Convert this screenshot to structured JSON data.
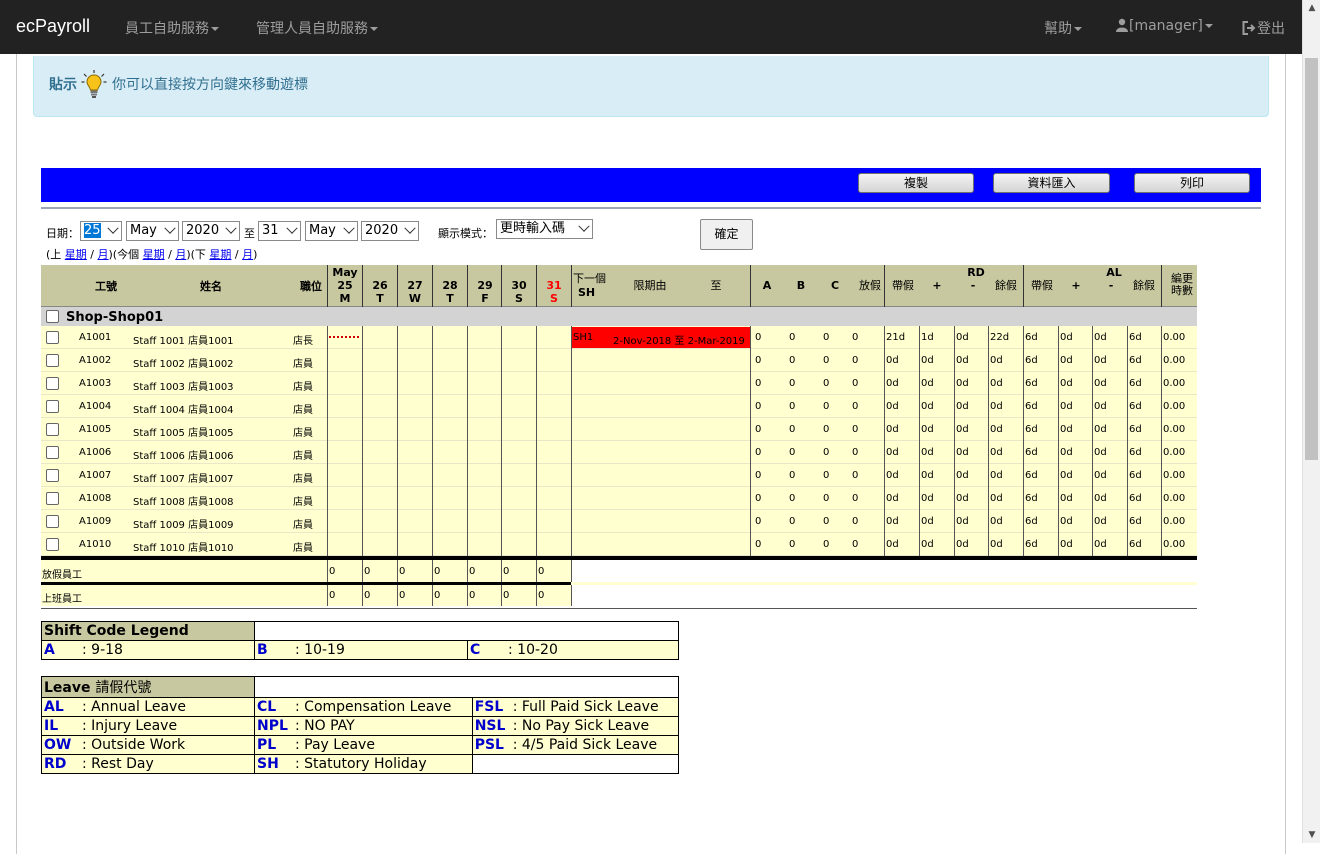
{
  "nav": {
    "brand": "ecPayroll",
    "employee_self_service": "員工自助服務",
    "manager_self_service": "管理人員自助服務",
    "help": "幫助",
    "user": "[manager]",
    "logout": "登出"
  },
  "tip": {
    "label": "貼示",
    "text": "你可以直接按方向鍵來移動遊標"
  },
  "toolbar": {
    "copy": "複製",
    "import": "資料匯入",
    "print": "列印"
  },
  "filters": {
    "date_label": "日期：",
    "to_label": "至",
    "from_day": "25",
    "from_month": "May",
    "from_year": "2020",
    "to_day": "31",
    "to_month": "May",
    "to_year": "2020",
    "mode_label": "顯示模式：",
    "mode_value": "更時輸入碼",
    "confirm": "確定",
    "prev_open": "(上",
    "week": "星期",
    "slash": "/",
    "month": "月",
    "this_open": ")(今個",
    "next_open": ")(下",
    "close": ")"
  },
  "table": {
    "headers": {
      "emp_no": "工號",
      "name": "姓名",
      "position": "職位",
      "next": "下一個",
      "next_code": "SH",
      "period_from": "限期由",
      "period_to": "至",
      "A": "A",
      "B": "B",
      "C": "C",
      "leave": "放假",
      "rd": "RD",
      "al": "AL",
      "with_leave": "帶假",
      "plus": "+",
      "minus": "-",
      "balance": "餘假",
      "shift_hours": "編更時數"
    },
    "days": [
      {
        "top": "May",
        "num": "25",
        "dow": "M",
        "red": false
      },
      {
        "top": "",
        "num": "26",
        "dow": "T",
        "red": false
      },
      {
        "top": "",
        "num": "27",
        "dow": "W",
        "red": false
      },
      {
        "top": "",
        "num": "28",
        "dow": "T",
        "red": false
      },
      {
        "top": "",
        "num": "29",
        "dow": "F",
        "red": false
      },
      {
        "top": "",
        "num": "30",
        "dow": "S",
        "red": false
      },
      {
        "top": "",
        "num": "31",
        "dow": "S",
        "red": true
      }
    ],
    "group": "Shop-Shop01",
    "rows": [
      {
        "id": "A1001",
        "name": "Staff 1001 店員1001",
        "pos": "店長",
        "A": "0",
        "B": "0",
        "C": "0",
        "leave": "0",
        "rd": [
          "21d",
          "1d",
          "0d",
          "22d"
        ],
        "al": [
          "6d",
          "0d",
          "0d",
          "6d"
        ],
        "hours": "0.00",
        "next": "SH1",
        "period": "2-Nov-2018 至 2-Mar-2019"
      },
      {
        "id": "A1002",
        "name": "Staff 1002 店員1002",
        "pos": "店員",
        "A": "0",
        "B": "0",
        "C": "0",
        "leave": "0",
        "rd": [
          "0d",
          "0d",
          "0d",
          "0d"
        ],
        "al": [
          "6d",
          "0d",
          "0d",
          "6d"
        ],
        "hours": "0.00"
      },
      {
        "id": "A1003",
        "name": "Staff 1003 店員1003",
        "pos": "店員",
        "A": "0",
        "B": "0",
        "C": "0",
        "leave": "0",
        "rd": [
          "0d",
          "0d",
          "0d",
          "0d"
        ],
        "al": [
          "6d",
          "0d",
          "0d",
          "6d"
        ],
        "hours": "0.00"
      },
      {
        "id": "A1004",
        "name": "Staff 1004 店員1004",
        "pos": "店員",
        "A": "0",
        "B": "0",
        "C": "0",
        "leave": "0",
        "rd": [
          "0d",
          "0d",
          "0d",
          "0d"
        ],
        "al": [
          "6d",
          "0d",
          "0d",
          "6d"
        ],
        "hours": "0.00"
      },
      {
        "id": "A1005",
        "name": "Staff 1005 店員1005",
        "pos": "店員",
        "A": "0",
        "B": "0",
        "C": "0",
        "leave": "0",
        "rd": [
          "0d",
          "0d",
          "0d",
          "0d"
        ],
        "al": [
          "6d",
          "0d",
          "0d",
          "6d"
        ],
        "hours": "0.00"
      },
      {
        "id": "A1006",
        "name": "Staff 1006 店員1006",
        "pos": "店員",
        "A": "0",
        "B": "0",
        "C": "0",
        "leave": "0",
        "rd": [
          "0d",
          "0d",
          "0d",
          "0d"
        ],
        "al": [
          "6d",
          "0d",
          "0d",
          "6d"
        ],
        "hours": "0.00"
      },
      {
        "id": "A1007",
        "name": "Staff 1007 店員1007",
        "pos": "店員",
        "A": "0",
        "B": "0",
        "C": "0",
        "leave": "0",
        "rd": [
          "0d",
          "0d",
          "0d",
          "0d"
        ],
        "al": [
          "6d",
          "0d",
          "0d",
          "6d"
        ],
        "hours": "0.00"
      },
      {
        "id": "A1008",
        "name": "Staff 1008 店員1008",
        "pos": "店員",
        "A": "0",
        "B": "0",
        "C": "0",
        "leave": "0",
        "rd": [
          "0d",
          "0d",
          "0d",
          "0d"
        ],
        "al": [
          "6d",
          "0d",
          "0d",
          "6d"
        ],
        "hours": "0.00"
      },
      {
        "id": "A1009",
        "name": "Staff 1009 店員1009",
        "pos": "店員",
        "A": "0",
        "B": "0",
        "C": "0",
        "leave": "0",
        "rd": [
          "0d",
          "0d",
          "0d",
          "0d"
        ],
        "al": [
          "6d",
          "0d",
          "0d",
          "6d"
        ],
        "hours": "0.00"
      },
      {
        "id": "A1010",
        "name": "Staff 1010 店員1010",
        "pos": "店員",
        "A": "0",
        "B": "0",
        "C": "0",
        "leave": "0",
        "rd": [
          "0d",
          "0d",
          "0d",
          "0d"
        ],
        "al": [
          "6d",
          "0d",
          "0d",
          "6d"
        ],
        "hours": "0.00"
      }
    ],
    "summary": [
      {
        "label": "放假員工",
        "values": [
          "0",
          "0",
          "0",
          "0",
          "0",
          "0",
          "0"
        ]
      },
      {
        "label": "上班員工",
        "values": [
          "0",
          "0",
          "0",
          "0",
          "0",
          "0",
          "0"
        ]
      }
    ]
  },
  "shift_legend": {
    "title": "Shift Code Legend",
    "items": [
      {
        "code": "A",
        "desc": ": 9-18"
      },
      {
        "code": "B",
        "desc": ": 10-19"
      },
      {
        "code": "C",
        "desc": ": 10-20"
      }
    ]
  },
  "leave_legend": {
    "title": "Leave",
    "title_cn": "請假代號",
    "items": [
      {
        "code": "AL",
        "desc": ": Annual Leave"
      },
      {
        "code": "CL",
        "desc": ": Compensation Leave"
      },
      {
        "code": "FSL",
        "desc": ": Full Paid Sick Leave"
      },
      {
        "code": "IL",
        "desc": ": Injury Leave"
      },
      {
        "code": "NPL",
        "desc": ": NO PAY"
      },
      {
        "code": "NSL",
        "desc": ": No Pay Sick Leave"
      },
      {
        "code": "OW",
        "desc": ": Outside Work"
      },
      {
        "code": "PL",
        "desc": ": Pay Leave"
      },
      {
        "code": "PSL",
        "desc": ": 4/5 Paid Sick Leave"
      },
      {
        "code": "RD",
        "desc": ": Rest Day"
      },
      {
        "code": "SH",
        "desc": ": Statutory Holiday"
      }
    ]
  },
  "colors": {
    "navbar": "#222222",
    "toolbar": "#0000ff",
    "row_bg": "#ffffd0",
    "header_bg": "#c8c8a0",
    "holiday_red": "#ff0000",
    "legend_code": "#0000cc"
  }
}
